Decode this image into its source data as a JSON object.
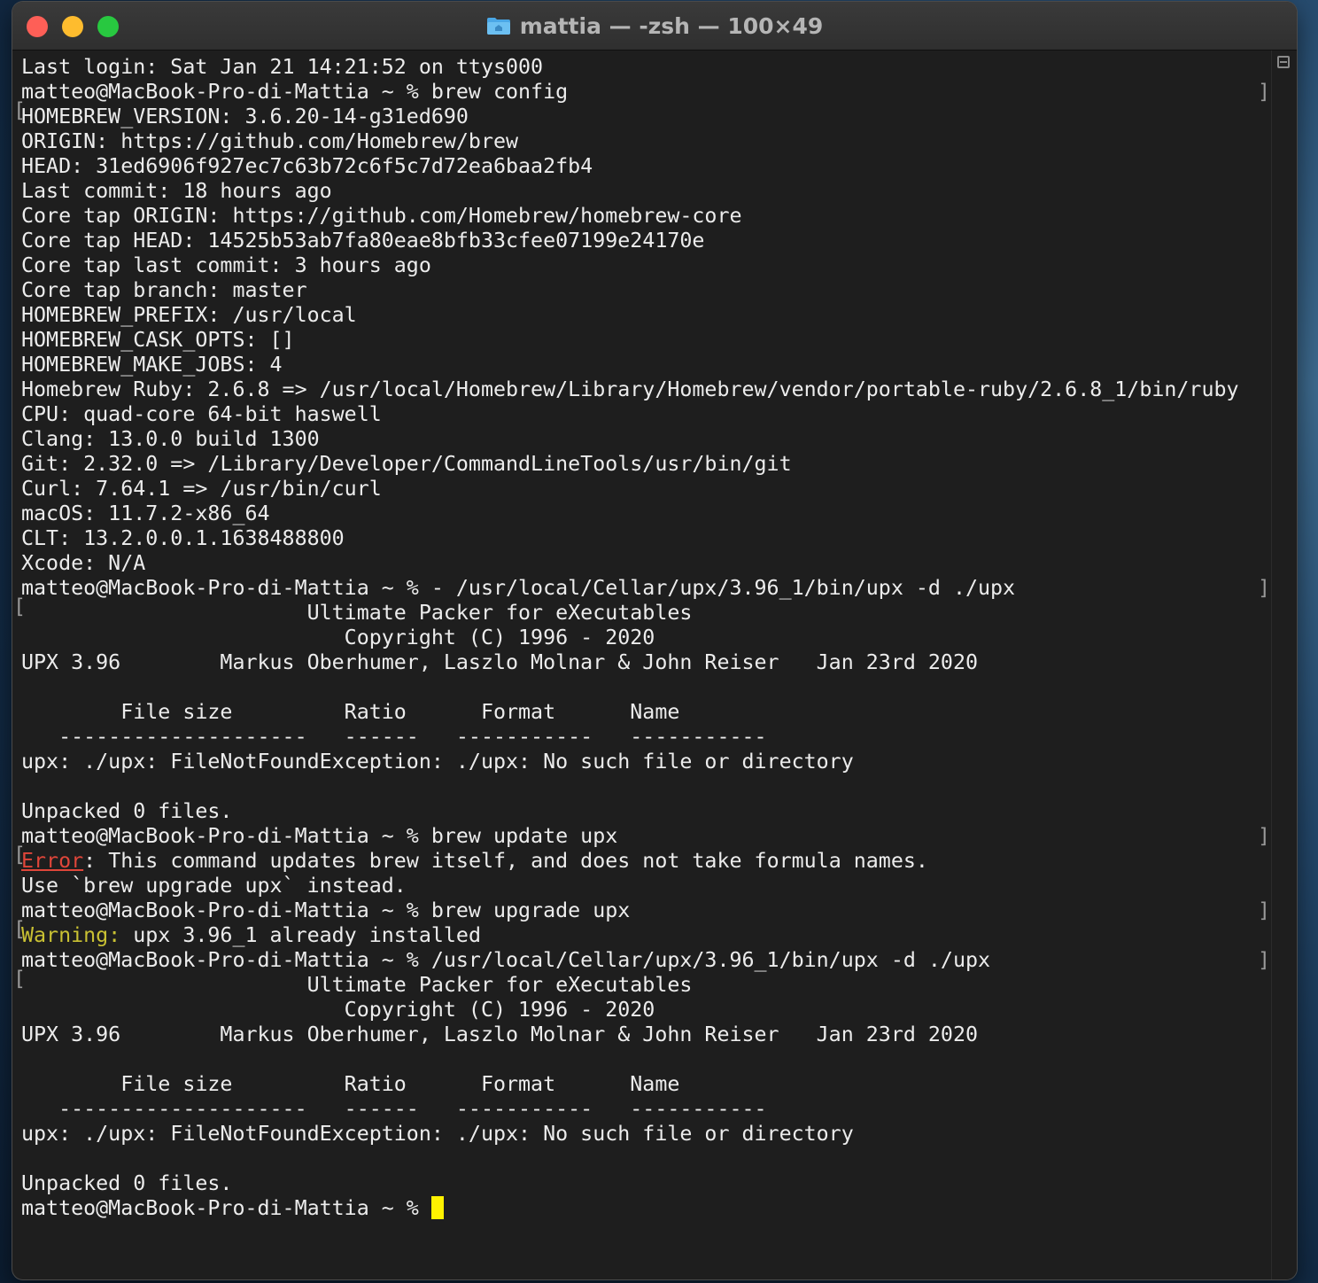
{
  "window": {
    "title": "mattia — -zsh — 100×49",
    "colors": {
      "background": "#1e1e1e",
      "text": "#ececec",
      "error": "#e0463a",
      "warning": "#c9c133",
      "cursor": "#fff200"
    }
  },
  "terminal": {
    "lines": [
      {
        "text": "Last login: Sat Jan 21 14:21:52 on ttys000"
      },
      {
        "text": "matteo@MacBook-Pro-di-Mattia ~ % brew config",
        "mark": true
      },
      {
        "text": "HOMEBREW_VERSION: 3.6.20-14-g31ed690"
      },
      {
        "text": "ORIGIN: https://github.com/Homebrew/brew"
      },
      {
        "text": "HEAD: 31ed6906f927ec7c63b72c6f5c7d72ea6baa2fb4"
      },
      {
        "text": "Last commit: 18 hours ago"
      },
      {
        "text": "Core tap ORIGIN: https://github.com/Homebrew/homebrew-core"
      },
      {
        "text": "Core tap HEAD: 14525b53ab7fa80eae8bfb33cfee07199e24170e"
      },
      {
        "text": "Core tap last commit: 3 hours ago"
      },
      {
        "text": "Core tap branch: master"
      },
      {
        "text": "HOMEBREW_PREFIX: /usr/local"
      },
      {
        "text": "HOMEBREW_CASK_OPTS: []"
      },
      {
        "text": "HOMEBREW_MAKE_JOBS: 4"
      },
      {
        "text": "Homebrew Ruby: 2.6.8 => /usr/local/Homebrew/Library/Homebrew/vendor/portable-ruby/2.6.8_1/bin/ruby"
      },
      {
        "text": "CPU: quad-core 64-bit haswell"
      },
      {
        "text": "Clang: 13.0.0 build 1300"
      },
      {
        "text": "Git: 2.32.0 => /Library/Developer/CommandLineTools/usr/bin/git"
      },
      {
        "text": "Curl: 7.64.1 => /usr/bin/curl"
      },
      {
        "text": "macOS: 11.7.2-x86_64"
      },
      {
        "text": "CLT: 13.2.0.0.1.1638488800"
      },
      {
        "text": "Xcode: N/A"
      },
      {
        "text": "matteo@MacBook-Pro-di-Mattia ~ % - /usr/local/Cellar/upx/3.96_1/bin/upx -d ./upx",
        "mark": true
      },
      {
        "text": "                       Ultimate Packer for eXecutables"
      },
      {
        "text": "                          Copyright (C) 1996 - 2020"
      },
      {
        "text": "UPX 3.96        Markus Oberhumer, Laszlo Molnar & John Reiser   Jan 23rd 2020"
      },
      {
        "text": ""
      },
      {
        "text": "        File size         Ratio      Format      Name"
      },
      {
        "text": "   --------------------   ------   -----------   -----------"
      },
      {
        "text": "upx: ./upx: FileNotFoundException: ./upx: No such file or directory"
      },
      {
        "text": ""
      },
      {
        "text": "Unpacked 0 files."
      },
      {
        "text": "matteo@MacBook-Pro-di-Mattia ~ % brew update upx",
        "mark": true
      },
      {
        "prefix": "Error",
        "prefix_style": "err",
        "text": ": This command updates brew itself, and does not take formula names."
      },
      {
        "text": "Use `brew upgrade upx` instead."
      },
      {
        "text": "matteo@MacBook-Pro-di-Mattia ~ % brew upgrade upx",
        "mark": true
      },
      {
        "prefix": "Warning:",
        "prefix_style": "warn",
        "text": " upx 3.96_1 already installed"
      },
      {
        "text": "matteo@MacBook-Pro-di-Mattia ~ % /usr/local/Cellar/upx/3.96_1/bin/upx -d ./upx",
        "mark": true
      },
      {
        "text": "                       Ultimate Packer for eXecutables"
      },
      {
        "text": "                          Copyright (C) 1996 - 2020"
      },
      {
        "text": "UPX 3.96        Markus Oberhumer, Laszlo Molnar & John Reiser   Jan 23rd 2020"
      },
      {
        "text": ""
      },
      {
        "text": "        File size         Ratio      Format      Name"
      },
      {
        "text": "   --------------------   ------   -----------   -----------"
      },
      {
        "text": "upx: ./upx: FileNotFoundException: ./upx: No such file or directory"
      },
      {
        "text": ""
      },
      {
        "text": "Unpacked 0 files."
      },
      {
        "text": "matteo@MacBook-Pro-di-Mattia ~ % ",
        "cursor": true
      }
    ]
  }
}
